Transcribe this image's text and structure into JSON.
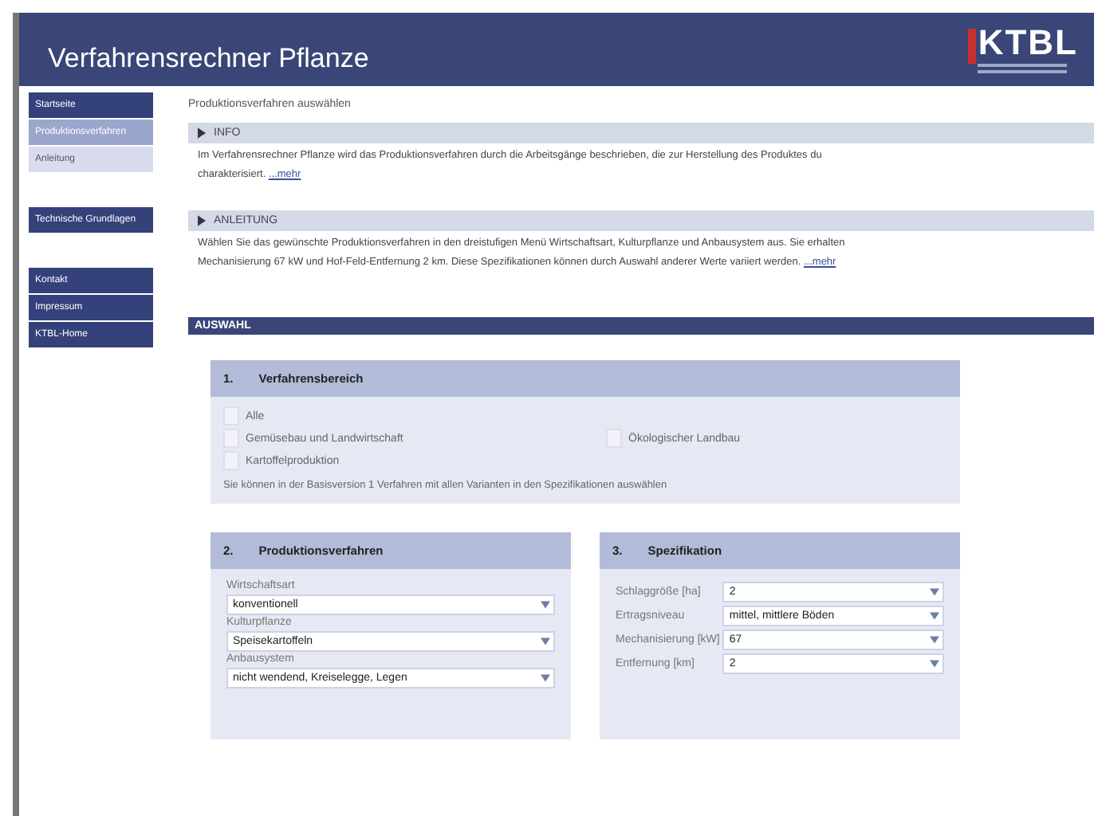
{
  "header": {
    "title": "Verfahrensrechner Pflanze",
    "logo": "KTBL"
  },
  "sidebar": {
    "groups": [
      {
        "items": [
          {
            "label": "Startseite",
            "selected": false
          },
          {
            "label": "Produktionsverfahren",
            "selected": true,
            "children": [
              {
                "label": "Anleitung",
                "selected": false
              }
            ]
          }
        ]
      },
      {
        "items": [
          {
            "label": "Technische Grundlagen",
            "selected": false
          }
        ]
      },
      {
        "items": [
          {
            "label": "Kontakt",
            "selected": false
          },
          {
            "label": "Impressum",
            "selected": false
          },
          {
            "label": "KTBL-Home",
            "selected": false
          }
        ]
      }
    ]
  },
  "breadcrumb": "Produktionsverfahren auswählen",
  "sections": [
    {
      "title": "INFO",
      "text": "Im Verfahrensrechner Pflanze wird das Produktionsverfahren durch die Arbeitsgänge beschrieben, die zur Herstellung des Produktes du",
      "text2": "charakterisiert.",
      "more": "...mehr"
    },
    {
      "title": "ANLEITUNG",
      "text": "Wählen Sie das gewünschte Produktionsverfahren in den dreistufigen Menü Wirtschaftsart, Kulturpflanze und Anbausystem aus. Sie erhalten",
      "text2": "Mechanisierung 67 kW und Hof-Feld-Entfernung 2 km. Diese Spezifikationen können durch Auswahl anderer Werte variiert werden.",
      "more": "...mehr"
    }
  ],
  "auswahl": {
    "title": "AUSWAHL",
    "bereich": {
      "number": "1.",
      "title": "Verfahrensbereich",
      "options": [
        {
          "label": "Alle",
          "checked": false
        },
        {
          "label": "Gemüsebau und Landwirtschaft",
          "checked": false
        },
        {
          "label": "Ökologischer Landbau",
          "checked": false
        },
        {
          "label": "Kartoffelproduktion",
          "checked": false
        }
      ],
      "note": "Sie können in der Basisversion 1 Verfahren mit allen Varianten in den Spezifikationen auswählen"
    },
    "produktion": {
      "number": "2.",
      "title": "Produktionsverfahren",
      "fields": [
        {
          "label": "Wirtschaftsart",
          "value": "konventionell"
        },
        {
          "label": "Kulturpflanze",
          "value": "Speisekartoffeln"
        },
        {
          "label": "Anbausystem",
          "value": "nicht wendend, Kreiselegge, Legen"
        }
      ]
    },
    "spezifikation": {
      "number": "3.",
      "title": "Spezifikation",
      "fields": [
        {
          "label": "Schlaggröße [ha]",
          "value": "2"
        },
        {
          "label": "Ertragsniveau",
          "value": "mittel, mittlere Böden"
        },
        {
          "label": "Mechanisierung [kW]",
          "value": "67"
        },
        {
          "label": "Entfernung [km]",
          "value": "2"
        }
      ]
    }
  }
}
